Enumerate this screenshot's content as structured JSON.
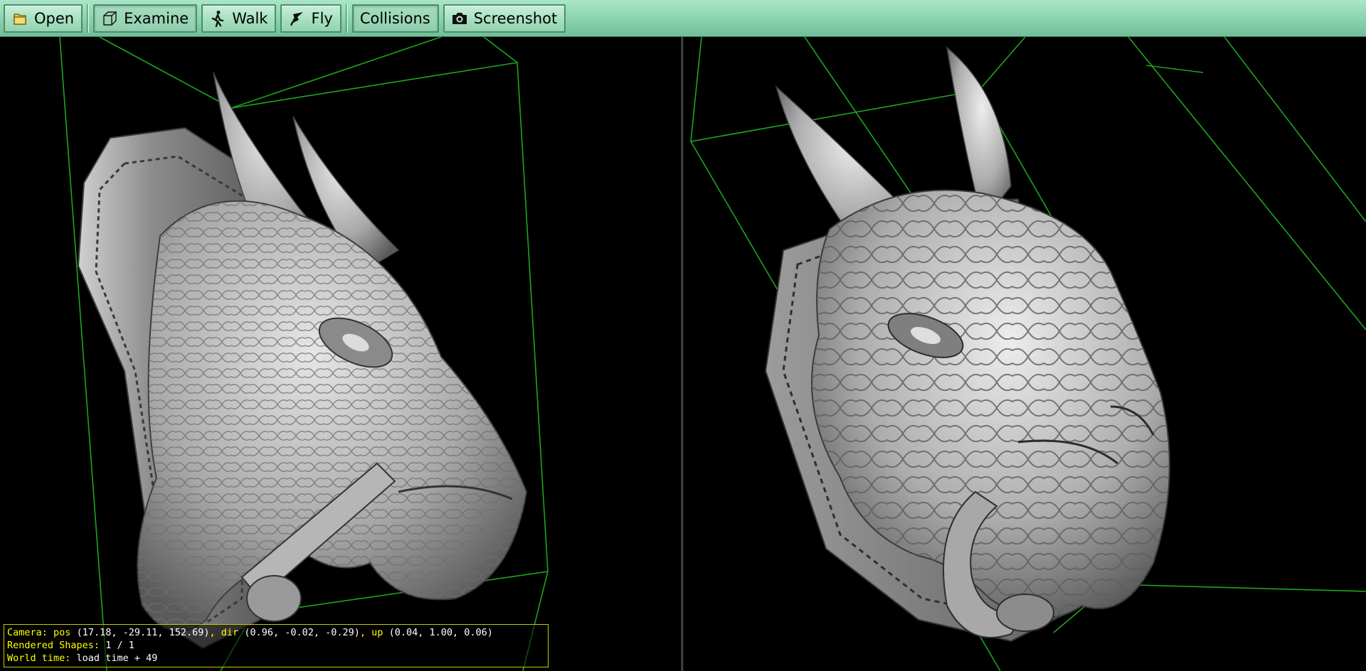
{
  "toolbar": {
    "buttons": [
      {
        "label": "Open",
        "icon": "folder-icon"
      },
      {
        "label": "Examine",
        "icon": "cube-icon"
      },
      {
        "label": "Walk",
        "icon": "walk-icon"
      },
      {
        "label": "Fly",
        "icon": "fly-icon"
      },
      {
        "label": "Collisions",
        "icon": ""
      },
      {
        "label": "Screenshot",
        "icon": "camera-icon"
      }
    ]
  },
  "camera_info": {
    "camera_label": "Camera:",
    "pos_label": "pos",
    "pos_value": "(17.18, -29.11, 152.69)",
    "sep1": ",",
    "dir_label": "dir",
    "dir_value": "(0.96, -0.02, -0.29)",
    "sep2": ",",
    "up_label": "up",
    "up_value": "(0.04, 1.00, 0.06)",
    "shapes_label": "Rendered Shapes:",
    "shapes_value": "1 / 1",
    "time_label": "World time:",
    "time_value": "load time + 49"
  },
  "colors": {
    "toolbar_bg": "#8fd6b2",
    "bounding_box": "#1ea51e",
    "model": "#bdbdbd",
    "overlay_label": "#ffff00",
    "overlay_border": "#c8c800"
  }
}
